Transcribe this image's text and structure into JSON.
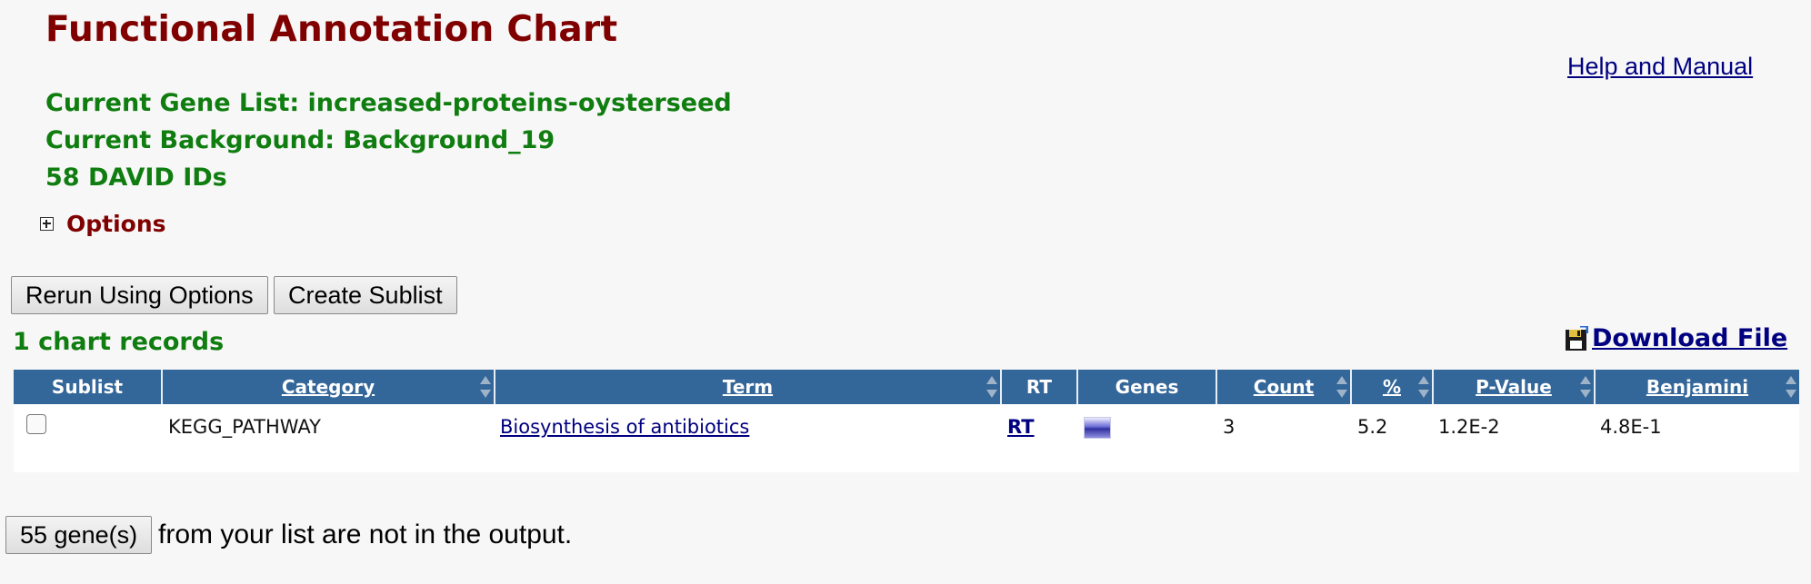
{
  "page_title": "Functional Annotation Chart",
  "help_link": "Help and Manual",
  "info": {
    "gene_list": "Current Gene List: increased-proteins-oysterseed",
    "background": "Current Background: Background_19",
    "id_count": "58 DAVID IDs"
  },
  "options_label": "Options",
  "buttons": {
    "rerun": "Rerun Using Options",
    "sublist": "Create Sublist",
    "genes_not_in_output": "55 gene(s)"
  },
  "records_label": "1 chart records",
  "download_label": "Download File",
  "table": {
    "headers": {
      "sublist": "Sublist",
      "category": "Category",
      "term": "Term",
      "rt": "RT",
      "genes": "Genes",
      "count": "Count",
      "percent": "%",
      "pvalue": "P-Value",
      "benjamini": "Benjamini"
    },
    "rows": [
      {
        "category": "KEGG_PATHWAY",
        "term": "Biosynthesis of antibiotics",
        "rt": "RT",
        "count": "3",
        "percent": "5.2",
        "pvalue": "1.2E-2",
        "benjamini": "4.8E-1"
      }
    ]
  },
  "footer_text": "from your list are not in the output.",
  "colors": {
    "title": "#800000",
    "info_green": "#0f7d0f",
    "header_bg": "#336699",
    "link": "#000080"
  },
  "icons": [
    "plus-box-icon",
    "floppy-disk-icon",
    "sort-arrows-icon",
    "gene-bar-icon"
  ]
}
